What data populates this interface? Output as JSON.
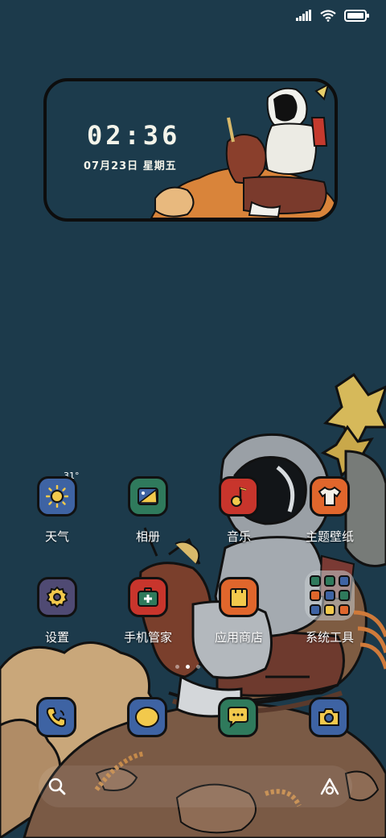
{
  "widget": {
    "time": "02:36",
    "date": "07月23日  星期五"
  },
  "weather": {
    "temperature": "31°"
  },
  "apps_row1": [
    {
      "label": "天气",
      "icon": "weather-sun-icon",
      "color": "#3e63a3"
    },
    {
      "label": "相册",
      "icon": "gallery-icon",
      "color": "#2f7a5c"
    },
    {
      "label": "音乐",
      "icon": "music-note-icon",
      "color": "#c8352c"
    },
    {
      "label": "主题壁纸",
      "icon": "tshirt-icon",
      "color": "#e0662c"
    }
  ],
  "apps_row2": [
    {
      "label": "设置",
      "icon": "gear-icon",
      "color": "#4f4a73"
    },
    {
      "label": "手机管家",
      "icon": "security-kit-icon",
      "color": "#c8352c"
    },
    {
      "label": "应用商店",
      "icon": "shopping-bag-icon",
      "color": "#e0662c"
    },
    {
      "label": "系统工具",
      "icon": "folder-icon",
      "color": "#9aa0a8"
    }
  ],
  "dock": [
    {
      "name": "phone",
      "icon": "phone-icon",
      "color": "#3e63a3"
    },
    {
      "name": "browser",
      "icon": "browser-circle-icon",
      "color": "#3e63a3"
    },
    {
      "name": "messages",
      "icon": "message-bubble-icon",
      "color": "#2f7a5c"
    },
    {
      "name": "camera",
      "icon": "camera-icon",
      "color": "#3e63a3"
    }
  ]
}
